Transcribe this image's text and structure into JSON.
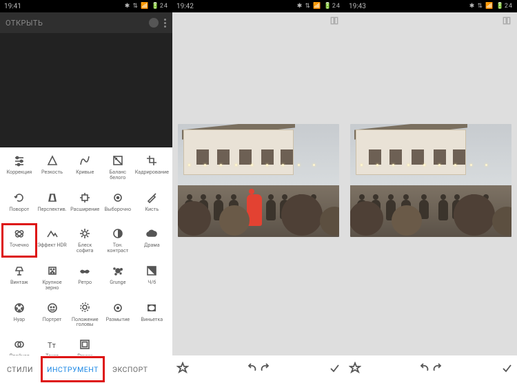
{
  "screens": [
    {
      "time": "19:41"
    },
    {
      "time": "19:42"
    },
    {
      "time": "19:43"
    }
  ],
  "topbar": {
    "open_label": "ОТКРЫТЬ"
  },
  "bottom_tabs": {
    "styles": "СТИЛИ",
    "instrument": "ИНСТРУМЕНТ",
    "export": "ЭКСПОРТ"
  },
  "tools": [
    {
      "id": "correction",
      "label": "Коррекция",
      "icon": "sliders"
    },
    {
      "id": "sharpness",
      "label": "Резкость",
      "icon": "triangle"
    },
    {
      "id": "curves",
      "label": "Кривые",
      "icon": "curve"
    },
    {
      "id": "white-balance",
      "label": "Баланс белого",
      "icon": "wb"
    },
    {
      "id": "crop",
      "label": "Кадрирование",
      "icon": "crop"
    },
    {
      "id": "rotate",
      "label": "Поворот",
      "icon": "rotate"
    },
    {
      "id": "perspective",
      "label": "Перспектив.",
      "icon": "persp"
    },
    {
      "id": "expand",
      "label": "Расширение",
      "icon": "expand"
    },
    {
      "id": "selective",
      "label": "Выборочно",
      "icon": "target"
    },
    {
      "id": "brush",
      "label": "Кисть",
      "icon": "brush"
    },
    {
      "id": "healing",
      "label": "Точечно",
      "icon": "bandaid",
      "highlighted": true
    },
    {
      "id": "hdr",
      "label": "Эффект HDR",
      "icon": "mountain"
    },
    {
      "id": "glamour",
      "label": "Блеск софита",
      "icon": "star"
    },
    {
      "id": "tonal",
      "label": "Тон. контраст",
      "icon": "halfcircle"
    },
    {
      "id": "drama",
      "label": "Драма",
      "icon": "cloud"
    },
    {
      "id": "vintage",
      "label": "Винтаж",
      "icon": "lamp"
    },
    {
      "id": "grainy",
      "label": "Крупное зерно",
      "icon": "grain"
    },
    {
      "id": "retro",
      "label": "Ретро",
      "icon": "mustache"
    },
    {
      "id": "grunge",
      "label": "Grunge",
      "icon": "splat"
    },
    {
      "id": "bw",
      "label": "Ч/б",
      "icon": "bw"
    },
    {
      "id": "noir",
      "label": "Нуар",
      "icon": "reel"
    },
    {
      "id": "portrait",
      "label": "Портрет",
      "icon": "face"
    },
    {
      "id": "headpose",
      "label": "Положение головы",
      "icon": "headpose"
    },
    {
      "id": "blur",
      "label": "Размытие",
      "icon": "blur"
    },
    {
      "id": "vignette",
      "label": "Виньетка",
      "icon": "vignette"
    },
    {
      "id": "double-exp",
      "label": "Двойная экспозиция",
      "icon": "dexp"
    },
    {
      "id": "text",
      "label": "Текст",
      "icon": "text"
    },
    {
      "id": "frames",
      "label": "Рамки",
      "icon": "frame"
    }
  ]
}
